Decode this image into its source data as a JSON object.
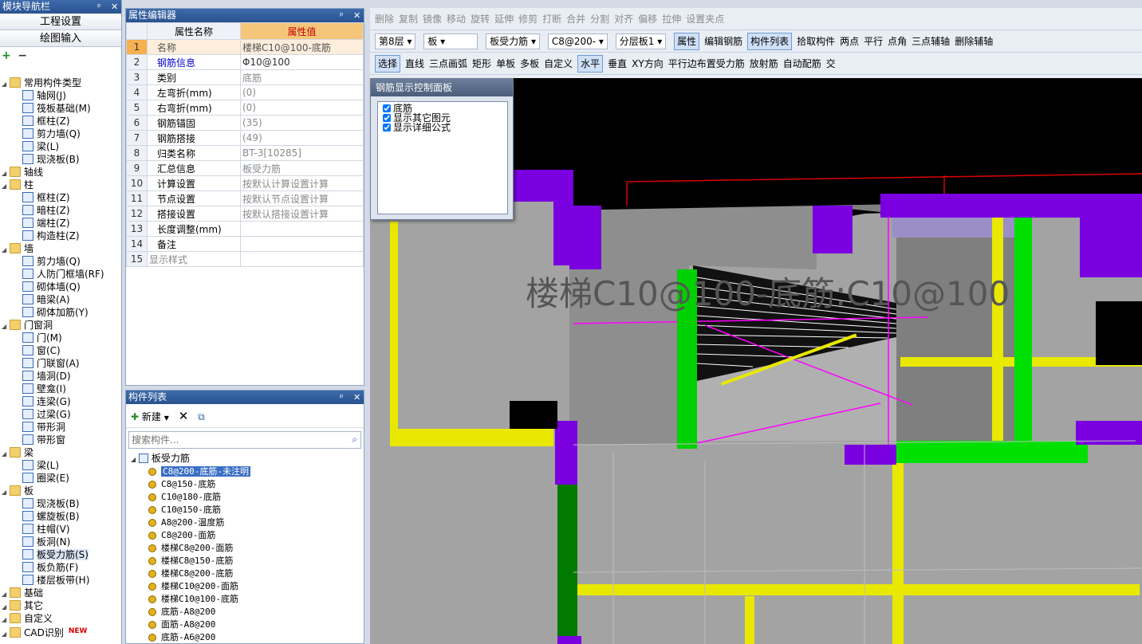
{
  "nav": {
    "title": "模块导航栏",
    "buttons": [
      "工程设置",
      "绘图输入"
    ],
    "tree": [
      {
        "label": "常用构件类型",
        "level": 0,
        "folder": true
      },
      {
        "label": "轴网(J)",
        "level": 1
      },
      {
        "label": "筏板基础(M)",
        "level": 1
      },
      {
        "label": "框柱(Z)",
        "level": 1
      },
      {
        "label": "剪力墙(Q)",
        "level": 1
      },
      {
        "label": "梁(L)",
        "level": 1
      },
      {
        "label": "现浇板(B)",
        "level": 1
      },
      {
        "label": "轴线",
        "level": 0,
        "folder": true
      },
      {
        "label": "柱",
        "level": 0,
        "folder": true
      },
      {
        "label": "框柱(Z)",
        "level": 1
      },
      {
        "label": "暗柱(Z)",
        "level": 1
      },
      {
        "label": "端柱(Z)",
        "level": 1
      },
      {
        "label": "构造柱(Z)",
        "level": 1
      },
      {
        "label": "墙",
        "level": 0,
        "folder": true
      },
      {
        "label": "剪力墙(Q)",
        "level": 1
      },
      {
        "label": "人防门框墙(RF)",
        "level": 1
      },
      {
        "label": "砌体墙(Q)",
        "level": 1
      },
      {
        "label": "暗梁(A)",
        "level": 1
      },
      {
        "label": "砌体加筋(Y)",
        "level": 1
      },
      {
        "label": "门窗洞",
        "level": 0,
        "folder": true
      },
      {
        "label": "门(M)",
        "level": 1
      },
      {
        "label": "窗(C)",
        "level": 1
      },
      {
        "label": "门联窗(A)",
        "level": 1
      },
      {
        "label": "墙洞(D)",
        "level": 1
      },
      {
        "label": "壁龛(I)",
        "level": 1
      },
      {
        "label": "连梁(G)",
        "level": 1
      },
      {
        "label": "过梁(G)",
        "level": 1
      },
      {
        "label": "带形洞",
        "level": 1
      },
      {
        "label": "带形窗",
        "level": 1
      },
      {
        "label": "梁",
        "level": 0,
        "folder": true
      },
      {
        "label": "梁(L)",
        "level": 1
      },
      {
        "label": "圈梁(E)",
        "level": 1
      },
      {
        "label": "板",
        "level": 0,
        "folder": true
      },
      {
        "label": "现浇板(B)",
        "level": 1
      },
      {
        "label": "螺旋板(B)",
        "level": 1
      },
      {
        "label": "柱帽(V)",
        "level": 1
      },
      {
        "label": "板洞(N)",
        "level": 1
      },
      {
        "label": "板受力筋(S)",
        "level": 1
      },
      {
        "label": "板负筋(F)",
        "level": 1
      },
      {
        "label": "楼层板带(H)",
        "level": 1
      },
      {
        "label": "基础",
        "level": 0,
        "folder": true
      },
      {
        "label": "其它",
        "level": 0,
        "folder": true
      },
      {
        "label": "自定义",
        "level": 0,
        "folder": true
      },
      {
        "label": "CAD识别",
        "level": 0,
        "folder": true
      }
    ],
    "new_badge": "NEW"
  },
  "prop": {
    "title": "属性编辑器",
    "col_name": "属性名称",
    "col_value": "属性值",
    "rows": [
      {
        "n": "1",
        "name": "名称",
        "value": "楼梯C10@100-底筋"
      },
      {
        "n": "2",
        "name": "钢筋信息",
        "value": "Φ10@100"
      },
      {
        "n": "3",
        "name": "类别",
        "value": "底筋"
      },
      {
        "n": "4",
        "name": "左弯折(mm)",
        "value": "(0)"
      },
      {
        "n": "5",
        "name": "右弯折(mm)",
        "value": "(0)"
      },
      {
        "n": "6",
        "name": "钢筋锚固",
        "value": "(35)"
      },
      {
        "n": "7",
        "name": "钢筋搭接",
        "value": "(49)"
      },
      {
        "n": "8",
        "name": "归类名称",
        "value": "BT-3[10285]"
      },
      {
        "n": "9",
        "name": "汇总信息",
        "value": "板受力筋"
      },
      {
        "n": "10",
        "name": "计算设置",
        "value": "按默认计算设置计算"
      },
      {
        "n": "11",
        "name": "节点设置",
        "value": "按默认节点设置计算"
      },
      {
        "n": "12",
        "name": "搭接设置",
        "value": "按默认搭接设置计算"
      },
      {
        "n": "13",
        "name": "长度调整(mm)",
        "value": ""
      },
      {
        "n": "14",
        "name": "备注",
        "value": ""
      },
      {
        "n": "15",
        "name": "显示样式",
        "value": ""
      }
    ]
  },
  "clist": {
    "title": "构件列表",
    "new_label": "新建",
    "search_placeholder": "搜索构件...",
    "root": "板受力筋",
    "items": [
      "C8@200-底筋-未注明",
      "C8@150-底筋",
      "C10@180-底筋",
      "C10@150-底筋",
      "A8@200-温度筋",
      "C8@200-面筋",
      "楼梯C8@200-面筋",
      "楼梯C8@150-底筋",
      "楼梯C8@200-底筋",
      "楼梯C10@200-面筋",
      "楼梯C10@100-底筋",
      "底筋-A8@200",
      "面筋-A8@200",
      "底筋-A6@200"
    ]
  },
  "toolbar1": [
    "删除",
    "复制",
    "镜像",
    "移动",
    "旋转",
    "延伸",
    "修剪",
    "打断",
    "合并",
    "分割",
    "对齐",
    "偏移",
    "拉伸",
    "设置夹点"
  ],
  "toolbar2": {
    "floor": "第8层",
    "type": "板",
    "sub": "板受力筋",
    "spec": "C8@200-",
    "layer": "分层板1",
    "buttons": [
      "属性",
      "编辑钢筋",
      "构件列表",
      "拾取构件",
      "两点",
      "平行",
      "点角",
      "三点辅轴",
      "删除辅轴"
    ]
  },
  "toolbar3": [
    "选择",
    "直线",
    "三点画弧",
    "矩形",
    "单板",
    "多板",
    "自定义",
    "水平",
    "垂直",
    "XY方向",
    "平行边布置受力筋",
    "放射筋",
    "自动配筋",
    "交"
  ],
  "rebar_panel": {
    "title": "钢筋显示控制面板",
    "options": [
      "底筋",
      "显示其它图元",
      "显示详细公式"
    ]
  },
  "canvas_label": "楼梯C10@100-底筋:C10@100",
  "colors": {
    "purple": "#7a00e0",
    "green": "#00e000",
    "dkgreen": "#007a00",
    "yellow": "#e8e800",
    "gray": "#a5a5a5",
    "accent": "#3a6fc4"
  }
}
